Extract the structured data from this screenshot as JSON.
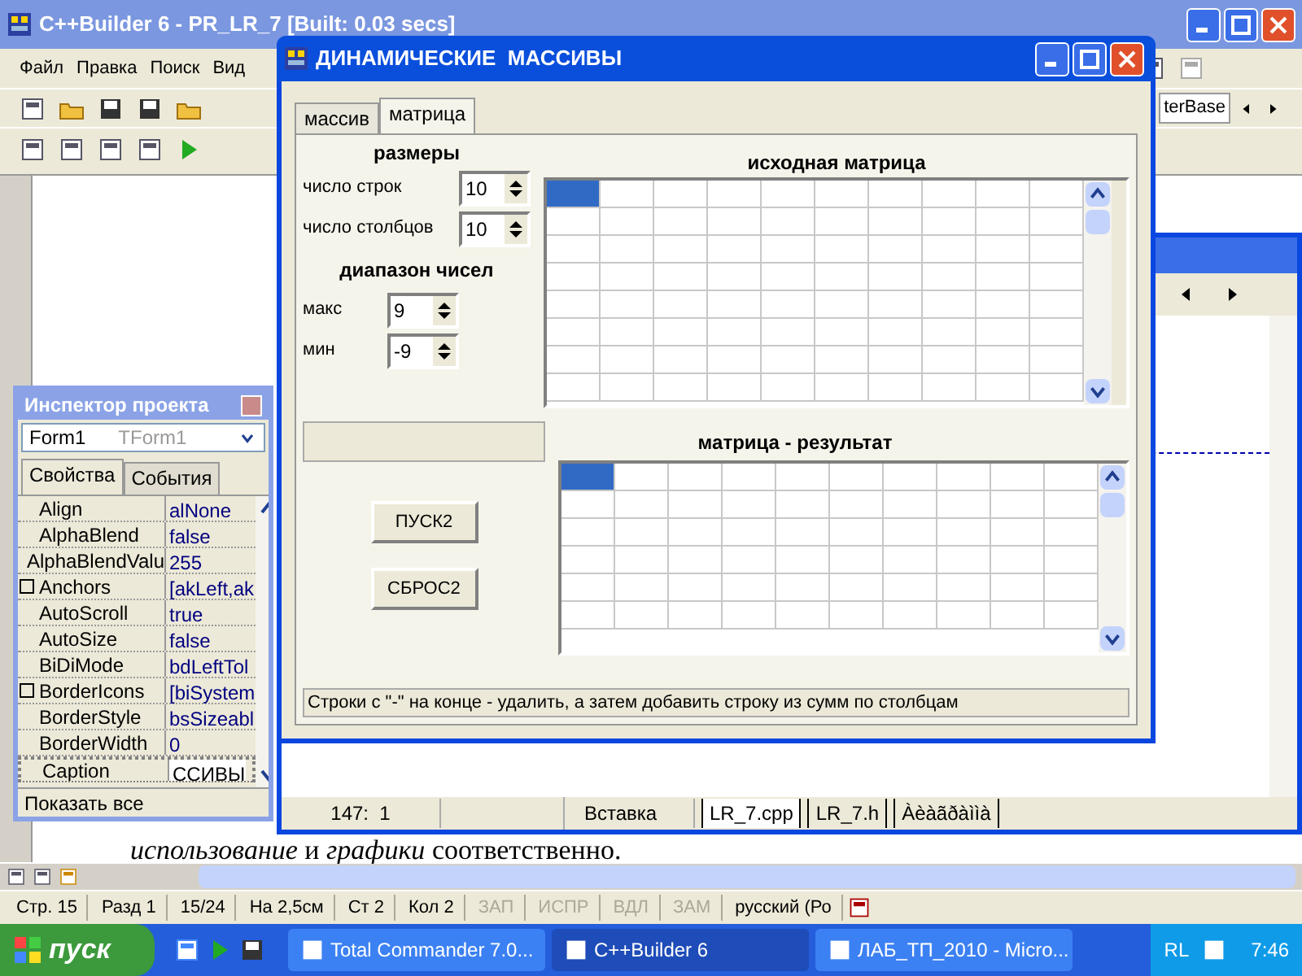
{
  "ide": {
    "title": "C++Builder 6 - PR_LR_7 [Built: 0.03 secs]",
    "menu": [
      "Файл",
      "Правка",
      "Поиск",
      "Вид"
    ],
    "palette_tab": "terBase"
  },
  "inspector": {
    "title": "Инспектор проекта",
    "object": "Form1",
    "object_type": "TForm1",
    "tabs": [
      {
        "label": "Свойства",
        "selected": true
      },
      {
        "label": "События",
        "selected": false
      }
    ],
    "properties": [
      {
        "name": "Align",
        "value": "alNone",
        "expandable": false,
        "selected": false
      },
      {
        "name": "AlphaBlend",
        "value": "false",
        "expandable": false,
        "selected": false
      },
      {
        "name": "AlphaBlendValu",
        "value": "255",
        "expandable": false,
        "selected": false
      },
      {
        "name": "Anchors",
        "value": "[akLeft,ak",
        "expandable": true,
        "selected": false
      },
      {
        "name": "AutoScroll",
        "value": "true",
        "expandable": false,
        "selected": false
      },
      {
        "name": "AutoSize",
        "value": "false",
        "expandable": false,
        "selected": false
      },
      {
        "name": "BiDiMode",
        "value": "bdLeftTol",
        "expandable": false,
        "selected": false
      },
      {
        "name": "BorderIcons",
        "value": "[biSystem",
        "expandable": true,
        "selected": false
      },
      {
        "name": "BorderStyle",
        "value": "bsSizeabl",
        "expandable": false,
        "selected": false
      },
      {
        "name": "BorderWidth",
        "value": "0",
        "expandable": false,
        "selected": false
      },
      {
        "name": "Caption",
        "value": "ССИВЫ",
        "expandable": false,
        "selected": true
      }
    ],
    "footer": "Показать все"
  },
  "editor": {
    "position": "147:  1",
    "mode": "Вставка",
    "tabs": [
      {
        "label": "LR_7.cpp",
        "selected": true
      },
      {
        "label": "LR_7.h",
        "selected": false
      },
      {
        "label": "Àèàãðàììà",
        "selected": false
      }
    ]
  },
  "dialog": {
    "title": "ДИНАМИЧЕСКИЕ  МАССИВЫ",
    "tabs": [
      {
        "label": "массив",
        "selected": false
      },
      {
        "label": "матрица",
        "selected": true
      }
    ],
    "sizes": {
      "title": "размеры",
      "fields": [
        {
          "label": "число строк",
          "value": "10"
        },
        {
          "label": "число столбцов",
          "value": "10"
        }
      ]
    },
    "range": {
      "title": "диапазон чисел",
      "fields": [
        {
          "label": "макс",
          "value": "9"
        },
        {
          "label": "мин",
          "value": "-9"
        }
      ]
    },
    "source": {
      "title": "исходная матрица",
      "rows": [
        [
          {
            "selected": true
          },
          {
            "selected": false
          },
          {
            "selected": false
          },
          {
            "selected": false
          },
          {
            "selected": false
          },
          {
            "selected": false
          },
          {
            "selected": false
          },
          {
            "selected": false
          },
          {
            "selected": false
          },
          {
            "selected": false
          }
        ],
        [
          {
            "selected": false
          },
          {
            "selected": false
          },
          {
            "selected": false
          },
          {
            "selected": false
          },
          {
            "selected": false
          },
          {
            "selected": false
          },
          {
            "selected": false
          },
          {
            "selected": false
          },
          {
            "selected": false
          },
          {
            "selected": false
          }
        ],
        [
          {
            "selected": false
          },
          {
            "selected": false
          },
          {
            "selected": false
          },
          {
            "selected": false
          },
          {
            "selected": false
          },
          {
            "selected": false
          },
          {
            "selected": false
          },
          {
            "selected": false
          },
          {
            "selected": false
          },
          {
            "selected": false
          }
        ],
        [
          {
            "selected": false
          },
          {
            "selected": false
          },
          {
            "selected": false
          },
          {
            "selected": false
          },
          {
            "selected": false
          },
          {
            "selected": false
          },
          {
            "selected": false
          },
          {
            "selected": false
          },
          {
            "selected": false
          },
          {
            "selected": false
          }
        ],
        [
          {
            "selected": false
          },
          {
            "selected": false
          },
          {
            "selected": false
          },
          {
            "selected": false
          },
          {
            "selected": false
          },
          {
            "selected": false
          },
          {
            "selected": false
          },
          {
            "selected": false
          },
          {
            "selected": false
          },
          {
            "selected": false
          }
        ],
        [
          {
            "selected": false
          },
          {
            "selected": false
          },
          {
            "selected": false
          },
          {
            "selected": false
          },
          {
            "selected": false
          },
          {
            "selected": false
          },
          {
            "selected": false
          },
          {
            "selected": false
          },
          {
            "selected": false
          },
          {
            "selected": false
          }
        ],
        [
          {
            "selected": false
          },
          {
            "selected": false
          },
          {
            "selected": false
          },
          {
            "selected": false
          },
          {
            "selected": false
          },
          {
            "selected": false
          },
          {
            "selected": false
          },
          {
            "selected": false
          },
          {
            "selected": false
          },
          {
            "selected": false
          }
        ],
        [
          {
            "selected": false
          },
          {
            "selected": false
          },
          {
            "selected": false
          },
          {
            "selected": false
          },
          {
            "selected": false
          },
          {
            "selected": false
          },
          {
            "selected": false
          },
          {
            "selected": false
          },
          {
            "selected": false
          },
          {
            "selected": false
          }
        ]
      ]
    },
    "result": {
      "title": "матрица - результат",
      "rows": [
        [
          {
            "selected": true
          },
          {
            "selected": false
          },
          {
            "selected": false
          },
          {
            "selected": false
          },
          {
            "selected": false
          },
          {
            "selected": false
          },
          {
            "selected": false
          },
          {
            "selected": false
          },
          {
            "selected": false
          },
          {
            "selected": false
          }
        ],
        [
          {
            "selected": false
          },
          {
            "selected": false
          },
          {
            "selected": false
          },
          {
            "selected": false
          },
          {
            "selected": false
          },
          {
            "selected": false
          },
          {
            "selected": false
          },
          {
            "selected": false
          },
          {
            "selected": false
          },
          {
            "selected": false
          }
        ],
        [
          {
            "selected": false
          },
          {
            "selected": false
          },
          {
            "selected": false
          },
          {
            "selected": false
          },
          {
            "selected": false
          },
          {
            "selected": false
          },
          {
            "selected": false
          },
          {
            "selected": false
          },
          {
            "selected": false
          },
          {
            "selected": false
          }
        ],
        [
          {
            "selected": false
          },
          {
            "selected": false
          },
          {
            "selected": false
          },
          {
            "selected": false
          },
          {
            "selected": false
          },
          {
            "selected": false
          },
          {
            "selected": false
          },
          {
            "selected": false
          },
          {
            "selected": false
          },
          {
            "selected": false
          }
        ],
        [
          {
            "selected": false
          },
          {
            "selected": false
          },
          {
            "selected": false
          },
          {
            "selected": false
          },
          {
            "selected": false
          },
          {
            "selected": false
          },
          {
            "selected": false
          },
          {
            "selected": false
          },
          {
            "selected": false
          },
          {
            "selected": false
          }
        ],
        [
          {
            "selected": false
          },
          {
            "selected": false
          },
          {
            "selected": false
          },
          {
            "selected": false
          },
          {
            "selected": false
          },
          {
            "selected": false
          },
          {
            "selected": false
          },
          {
            "selected": false
          },
          {
            "selected": false
          },
          {
            "selected": false
          }
        ]
      ]
    },
    "buttons": [
      "ПУСК2",
      "СБРОС2"
    ],
    "status": "Строки с \"-\" на конце - удалить, а затем добавить строку из сумм по столбцам"
  },
  "document": {
    "text": "*использование* и *графики* соответственно."
  },
  "word_status": [
    {
      "text": "Стр. 15",
      "disabled": false
    },
    {
      "text": "Разд 1",
      "disabled": false
    },
    {
      "text": "15/24",
      "disabled": false
    },
    {
      "text": "На 2,5см",
      "disabled": false
    },
    {
      "text": "Ст 2",
      "disabled": false
    },
    {
      "text": "Кол 2",
      "disabled": false
    },
    {
      "text": "ЗАП",
      "disabled": true
    },
    {
      "text": "ИСПР",
      "disabled": true
    },
    {
      "text": "ВДЛ",
      "disabled": true
    },
    {
      "text": "ЗАМ",
      "disabled": true
    },
    {
      "text": "русский (Ро",
      "disabled": false
    }
  ],
  "taskbar": {
    "start": "пуск",
    "tasks": [
      {
        "label": "Total Commander 7.0...",
        "selected": false
      },
      {
        "label": "C++Builder 6",
        "selected": true
      },
      {
        "label": "ЛАБ_ТП_2010 - Micro...",
        "selected": false
      }
    ],
    "language": "RL",
    "clock": "7:46"
  }
}
